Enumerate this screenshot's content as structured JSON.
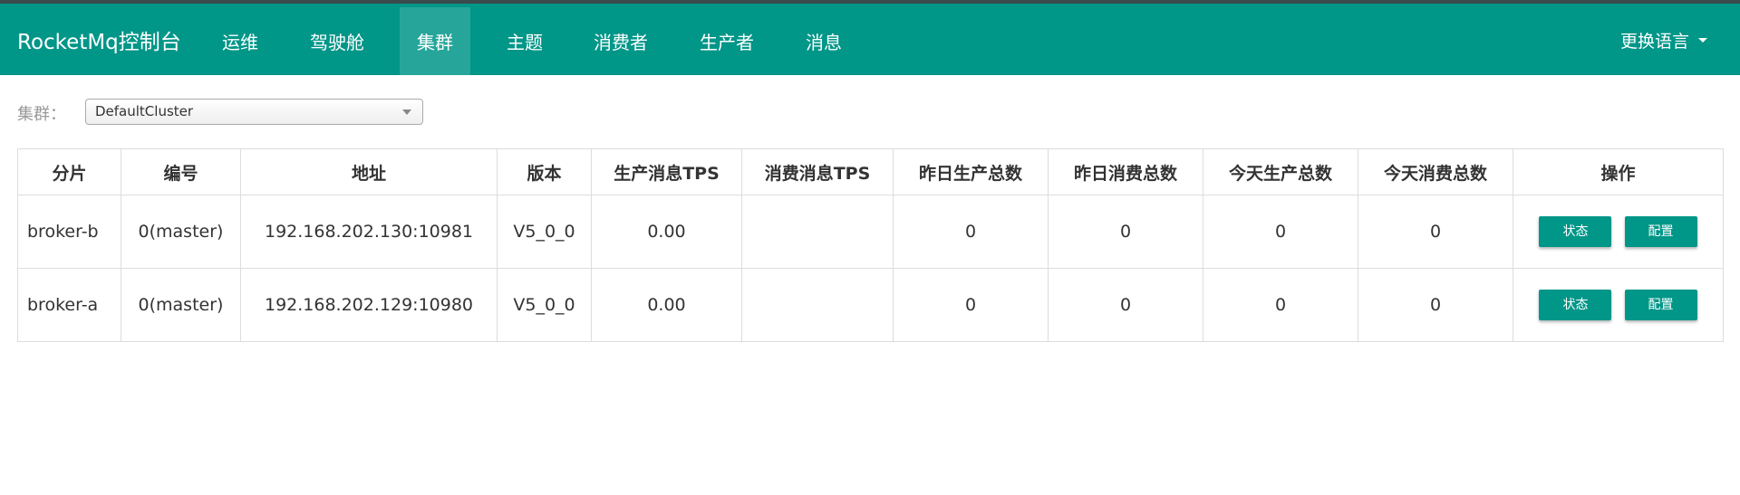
{
  "app": {
    "title": "RocketMq控制台"
  },
  "nav": {
    "items": [
      {
        "label": "运维",
        "active": false
      },
      {
        "label": "驾驶舱",
        "active": false
      },
      {
        "label": "集群",
        "active": true
      },
      {
        "label": "主题",
        "active": false
      },
      {
        "label": "消费者",
        "active": false
      },
      {
        "label": "生产者",
        "active": false
      },
      {
        "label": "消息",
        "active": false
      }
    ],
    "language_label": "更换语言"
  },
  "filter": {
    "label": "集群：",
    "selected": "DefaultCluster"
  },
  "table": {
    "headers": [
      "分片",
      "编号",
      "地址",
      "版本",
      "生产消息TPS",
      "消费消息TPS",
      "昨日生产总数",
      "昨日消费总数",
      "今天生产总数",
      "今天消费总数",
      "操作"
    ],
    "rows": [
      {
        "shard": "broker-b",
        "id": "0(master)",
        "address": "192.168.202.130:10981",
        "version": "V5_0_0",
        "produce_tps": "0.00",
        "consume_tps": "",
        "yesterday_produce": "0",
        "yesterday_consume": "0",
        "today_produce": "0",
        "today_consume": "0"
      },
      {
        "shard": "broker-a",
        "id": "0(master)",
        "address": "192.168.202.129:10980",
        "version": "V5_0_0",
        "produce_tps": "0.00",
        "consume_tps": "",
        "yesterday_produce": "0",
        "yesterday_consume": "0",
        "today_produce": "0",
        "today_consume": "0"
      }
    ],
    "actions": {
      "status_label": "状态",
      "config_label": "配置"
    }
  },
  "colors": {
    "primary": "#009688",
    "active_tab": "#26a69a"
  },
  "icons": {
    "language_caret": "caret-down-icon",
    "select_arrow": "dropdown-arrow-icon"
  }
}
